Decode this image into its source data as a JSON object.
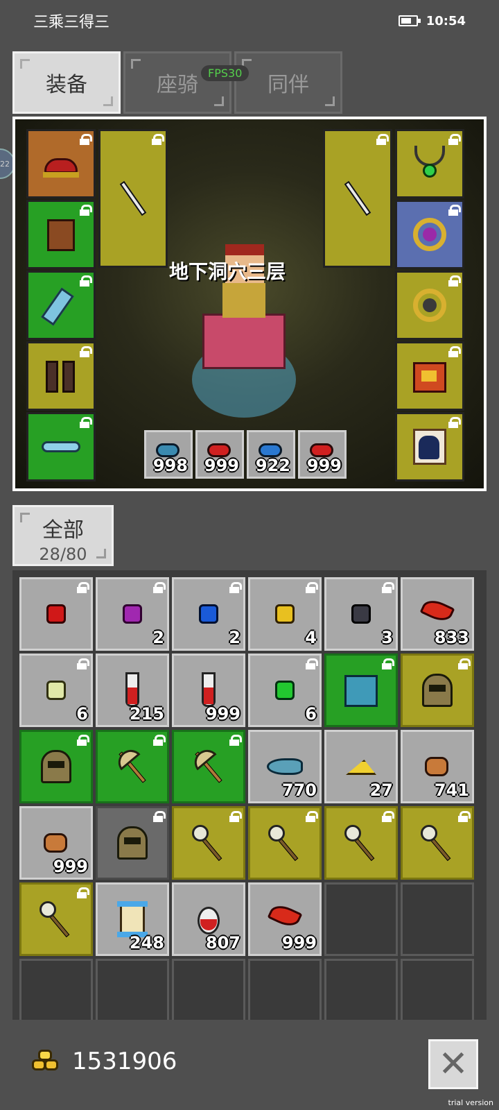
{
  "status_bar": {
    "title": "三乘三得三",
    "time": "10:54"
  },
  "tabs": [
    {
      "label": "装备",
      "active": true
    },
    {
      "label": "座骑",
      "active": false
    },
    {
      "label": "同伴",
      "active": false
    }
  ],
  "fps": "FPS30",
  "side_bubble": "22",
  "scene": {
    "location": "地下洞穴三层",
    "potions": [
      {
        "icon": "blue-potion-icon",
        "count": "998"
      },
      {
        "icon": "red-potion-icon",
        "count": "999"
      },
      {
        "icon": "blue-potion-icon",
        "count": "922"
      },
      {
        "icon": "red-potion-icon",
        "count": "999"
      }
    ]
  },
  "inventory": {
    "category_label": "全部",
    "capacity": "28/80",
    "cells": [
      {
        "icon": "red-gem-icon",
        "count": "",
        "style": "grey",
        "locked": true
      },
      {
        "icon": "purple-gem-icon",
        "count": "2",
        "style": "grey",
        "locked": true
      },
      {
        "icon": "blue-gem-icon",
        "count": "2",
        "style": "grey",
        "locked": true
      },
      {
        "icon": "yellow-gem-icon",
        "count": "4",
        "style": "grey",
        "locked": true
      },
      {
        "icon": "black-gem-icon",
        "count": "3",
        "style": "grey",
        "locked": true
      },
      {
        "icon": "red-feather-icon",
        "count": "833",
        "style": "grey",
        "locked": false
      },
      {
        "icon": "pale-gem-icon",
        "count": "6",
        "style": "grey",
        "locked": true
      },
      {
        "icon": "red-vial-icon",
        "count": "215",
        "style": "grey",
        "locked": false
      },
      {
        "icon": "red-vial-icon",
        "count": "999",
        "style": "grey",
        "locked": false
      },
      {
        "icon": "green-gem-icon",
        "count": "6",
        "style": "grey",
        "locked": true
      },
      {
        "icon": "blue-armor-icon",
        "count": "",
        "style": "green",
        "locked": true
      },
      {
        "icon": "helmet-icon",
        "count": "",
        "style": "olive",
        "locked": true
      },
      {
        "icon": "helmet-icon",
        "count": "",
        "style": "green",
        "locked": true
      },
      {
        "icon": "axe-icon",
        "count": "",
        "style": "green",
        "locked": true
      },
      {
        "icon": "axe-icon",
        "count": "",
        "style": "green",
        "locked": true
      },
      {
        "icon": "fish-icon",
        "count": "770",
        "style": "grey",
        "locked": false
      },
      {
        "icon": "cheese-icon",
        "count": "27",
        "style": "grey",
        "locked": false
      },
      {
        "icon": "ore-icon",
        "count": "741",
        "style": "grey",
        "locked": false
      },
      {
        "icon": "ore-icon",
        "count": "999",
        "style": "grey",
        "locked": false
      },
      {
        "icon": "helmet-icon",
        "count": "",
        "style": "darkgrey",
        "locked": true
      },
      {
        "icon": "mace-icon",
        "count": "",
        "style": "olive",
        "locked": true
      },
      {
        "icon": "mace-icon",
        "count": "",
        "style": "olive",
        "locked": true
      },
      {
        "icon": "mace-icon",
        "count": "",
        "style": "olive",
        "locked": true
      },
      {
        "icon": "mace-icon",
        "count": "",
        "style": "olive",
        "locked": true
      },
      {
        "icon": "mace-icon",
        "count": "",
        "style": "olive",
        "locked": true
      },
      {
        "icon": "scroll-icon",
        "count": "248",
        "style": "grey",
        "locked": false
      },
      {
        "icon": "red-potion-icon",
        "count": "807",
        "style": "grey",
        "locked": false
      },
      {
        "icon": "red-feather-icon",
        "count": "999",
        "style": "grey",
        "locked": false
      },
      {
        "icon": "",
        "count": "",
        "style": "empty",
        "locked": false
      },
      {
        "icon": "",
        "count": "",
        "style": "empty",
        "locked": false
      },
      {
        "icon": "",
        "count": "",
        "style": "empty",
        "locked": false
      },
      {
        "icon": "",
        "count": "",
        "style": "empty",
        "locked": false
      },
      {
        "icon": "",
        "count": "",
        "style": "empty",
        "locked": false
      },
      {
        "icon": "",
        "count": "",
        "style": "empty",
        "locked": false
      },
      {
        "icon": "",
        "count": "",
        "style": "empty",
        "locked": false
      },
      {
        "icon": "",
        "count": "",
        "style": "empty",
        "locked": false
      }
    ]
  },
  "gold": "1531906",
  "watermark": "trial version",
  "colors": {
    "slot_green": "#27a024",
    "slot_olive": "#a9a225",
    "slot_blue": "#5b6fb0",
    "slot_brown": "#b06a2a",
    "fps_green": "#55d04c"
  }
}
